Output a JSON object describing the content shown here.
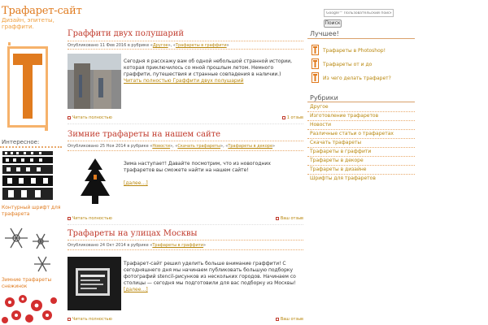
{
  "site": {
    "title": "Трафарет-сайт",
    "description": "Дизайн, эпитеты, граффити."
  },
  "left": {
    "interesting_title": "Интересное:",
    "caption1": "Контурный шрифт для трафарета",
    "caption2": "Зимние трафареты снежинок"
  },
  "search": {
    "placeholder": "Google™ Пользовательский поиск",
    "button_label": "Поиск"
  },
  "posts": [
    {
      "title": "Граффити двух полушарий",
      "meta_prefix": "Опубликовано 11 Фев 2016 в рубрике «",
      "rubrics": [
        "Другое",
        "Трафареты в граффити"
      ],
      "body": "Сегодня я расскажу вам об одной небольшой странной истории, которая приключилось со мной прошлым летом. Немного граффити, путешествия и странные совпадения в наличии.)",
      "more": "Читать полностью Граффити двух полушарий",
      "read_full": "Читать полностью",
      "comments": "1 отзыв"
    },
    {
      "title": "Зимние трафареты на нашем сайте",
      "meta_prefix": "Опубликовано 25 Ноя 2014 в рубрике «",
      "rubrics": [
        "Новости",
        "Скачать трафареты",
        "Трафареты в декоре"
      ],
      "body": "Зима наступает! Давайте посмотрим, что из новогодних трафаретов вы сможете найти на нашем сайте!",
      "more": "[далее…]",
      "read_full": "Читать полностью",
      "comments": "Ваш отзыв"
    },
    {
      "title": "Трафареты на улицах Москвы",
      "meta_prefix": "Опубликовано 24 Окт 2014 в рубрике «",
      "rubrics": [
        "Трафареты в граффити"
      ],
      "body": "Трафарет-сайт решил уделить больше внимание граффити! С сегодняшнего дня мы начинаем публиковать большую подборку фотографий stencil-рисунков из нескольких городов. Начинаем со столицы — сегодня мы подготовили для вас подборку из Москвы!",
      "more": "[далее…]",
      "read_full": "Читать полностью",
      "comments": "Ваш отзыв"
    }
  ],
  "sidebar": {
    "best_title": "Лучшее!",
    "best_items": [
      "Трафареты в Photoshop!",
      "Трафареты от и до",
      "Из чего делать трафарет?"
    ],
    "rubrics_title": "Рубрики",
    "rubrics": [
      "Другое",
      "Изготовление трафаретов",
      "Новости",
      "Различные статьи о трафаретах",
      "Скачать трафареты",
      "Трафареты в граффити",
      "Трафареты в декоре",
      "Трафареты в дизайне",
      "Шрифты для трафаретов"
    ]
  },
  "colors": {
    "accent": "#e07b1f",
    "title_red": "#c0392b",
    "link": "#b8860b"
  }
}
